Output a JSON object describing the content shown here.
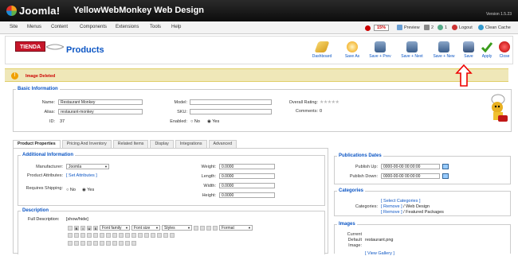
{
  "header": {
    "logo": "Joomla!",
    "site": "YellowWebMonkey Web Design",
    "version": "Version 1.5.23"
  },
  "menu": {
    "items": [
      "Site",
      "Menus",
      "Content",
      "Components",
      "Extensions",
      "Tools",
      "Help"
    ],
    "status": {
      "badge": "15%",
      "preview": "Preview",
      "messages": "2",
      "users": "1",
      "logout": "Logout",
      "clean": "Clean Cache"
    }
  },
  "toolbar": {
    "brand": "TIENDA",
    "title": "Products",
    "buttons": [
      "Dashboard",
      "Save As",
      "Save + Prev",
      "Save + Next",
      "Save + New",
      "Save",
      "Apply",
      "Close"
    ]
  },
  "message": "Image Deleted",
  "basic": {
    "legend": "Basic Information",
    "name_label": "Name:",
    "name": "Restaurant Monkey",
    "alias_label": "Alias:",
    "alias": "restaurant-monkey",
    "id_label": "ID:",
    "id": "37",
    "model_label": "Model:",
    "sku_label": "SKU:",
    "enabled_label": "Enabled:",
    "no": "No",
    "yes": "Yes",
    "rating_label": "Overall Rating:",
    "comments_label": "Comments:",
    "comments": "0"
  },
  "tabs": [
    "Product Properties",
    "Pricing And Inventory",
    "Related Items",
    "Display",
    "Integrations",
    "Advanced"
  ],
  "additional": {
    "legend": "Additional Information",
    "manufacturer_label": "Manufacturer:",
    "manufacturer": "Joomla",
    "attributes_label": "Product Attributes:",
    "attributes_link": "[ Set Attributes ]",
    "shipping_label": "Requires Shipping:",
    "no": "No",
    "yes": "Yes",
    "weight_label": "Weight:",
    "weight": "0.0000",
    "length_label": "Length:",
    "length": "0.0000",
    "width_label": "Width:",
    "width": "0.0000",
    "height_label": "Height:",
    "height": "0.0000"
  },
  "description": {
    "legend": "Description",
    "full_label": "Full Description:",
    "toggle": "[show/hide]",
    "font_family": "Font family",
    "font_size": "Font size",
    "styles": "Styles",
    "format": "Format"
  },
  "publication": {
    "legend": "Publications Dates",
    "up_label": "Publish Up:",
    "up": "0000-00-00 00:00:00",
    "down_label": "Publish Down:",
    "down": "0000-00-00 00:00:00"
  },
  "categories": {
    "legend": "Categories",
    "label": "Categories:",
    "select": "[ Select Categories ]",
    "remove": "[ Remove ]",
    "cat1": "/ Web Design",
    "cat2": "/ Featured Packages"
  },
  "images": {
    "legend": "Images",
    "current_label": "Current Default Image:",
    "current": "restaurant.png",
    "gallery": "[ View Gallery ]"
  }
}
